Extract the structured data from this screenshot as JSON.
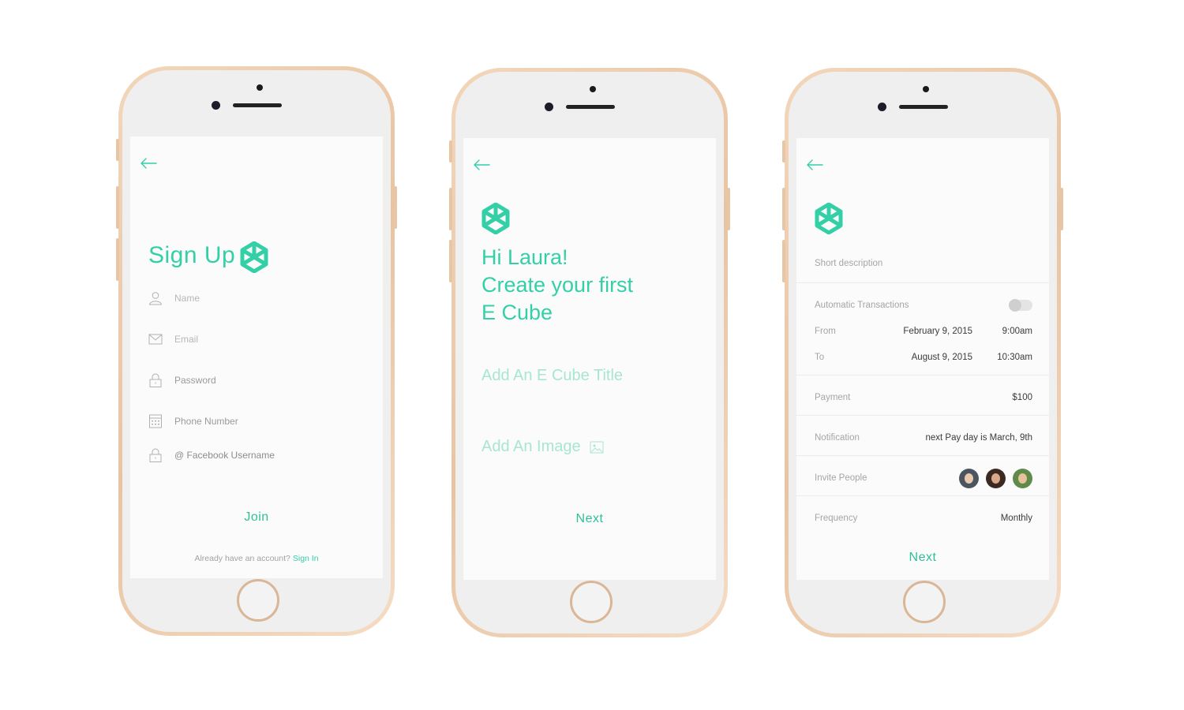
{
  "colors": {
    "accent": "#33d0a7",
    "phone_frame": "#ecc9a8"
  },
  "screen1": {
    "title": "Sign Up",
    "fields": [
      {
        "icon": "user-icon",
        "label": "Name"
      },
      {
        "icon": "envelope-icon",
        "label": "Email"
      },
      {
        "icon": "lock-icon",
        "label": "Password"
      },
      {
        "icon": "keypad-icon",
        "label": "Phone Number"
      },
      {
        "icon": "lock-icon",
        "label": "@ Facebook Username"
      }
    ],
    "join_label": "Join",
    "already_text": "Already have an account?",
    "signin_label": "Sign In"
  },
  "screen2": {
    "greeting_line1": "Hi Laura!",
    "greeting_line2": "Create your first",
    "greeting_line3": "E Cube",
    "title_placeholder": "Add An E Cube Title",
    "image_placeholder": "Add An Image",
    "next_label": "Next"
  },
  "screen3": {
    "short_description": "Short description",
    "auto_transactions_label": "Automatic Transactions",
    "auto_transactions_on": false,
    "from_label": "From",
    "from_date": "February 9, 2015",
    "from_time": "9:00am",
    "to_label": "To",
    "to_date": "August 9, 2015",
    "to_time": "10:30am",
    "payment_label": "Payment",
    "payment_value": "$100",
    "notification_label": "Notification",
    "notification_value": "next Pay day is March, 9th",
    "invite_label": "Invite People",
    "frequency_label": "Frequency",
    "frequency_value": "Monthly",
    "next_label": "Next"
  }
}
